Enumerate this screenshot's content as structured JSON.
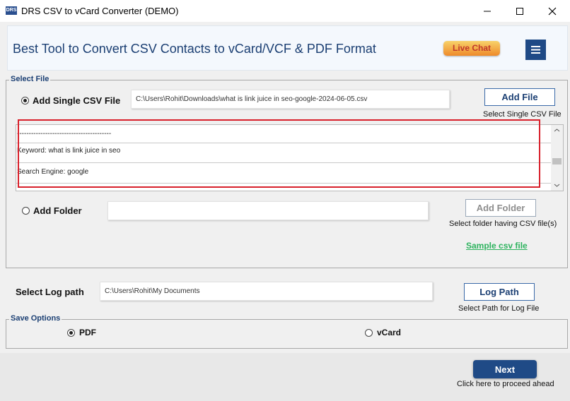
{
  "window": {
    "title": "DRS CSV to vCard Converter (DEMO)",
    "icon_text": "DRS"
  },
  "banner": {
    "title": "Best Tool to Convert CSV Contacts to vCard/VCF & PDF Format",
    "live_chat_label": "Live Chat"
  },
  "select_file": {
    "legend": "Select File",
    "single_csv": {
      "label": "Add Single CSV File",
      "selected": true,
      "path_value": "C:\\Users\\Rohit\\Downloads\\what is link juice in seo-google-2024-06-05.csv",
      "button_label": "Add File",
      "hint": "Select Single CSV File"
    },
    "log_lines": [
      "----------------------------------------",
      "Keyword: what is link juice in seo",
      "Search Engine: google"
    ],
    "folder": {
      "label": "Add Folder",
      "selected": false,
      "path_value": "",
      "button_label": "Add Folder",
      "hint": "Select folder having CSV file(s)"
    },
    "sample_link": "Sample csv file"
  },
  "log_path": {
    "label": "Select Log path",
    "value": "C:\\Users\\Rohit\\My Documents",
    "button_label": "Log Path",
    "hint": "Select Path for Log File"
  },
  "save_options": {
    "legend": "Save Options",
    "options": [
      {
        "label": "PDF",
        "selected": true
      },
      {
        "label": "vCard",
        "selected": false
      }
    ]
  },
  "footer": {
    "next_label": "Next",
    "next_caption": "Click here to proceed ahead"
  },
  "colors": {
    "brand_blue": "#1f4a86",
    "live_chat_gradient_top": "#f8d26a",
    "live_chat_gradient_bottom": "#ee8a2a",
    "highlight_red": "#d8202b",
    "link_green": "#2db35e"
  }
}
